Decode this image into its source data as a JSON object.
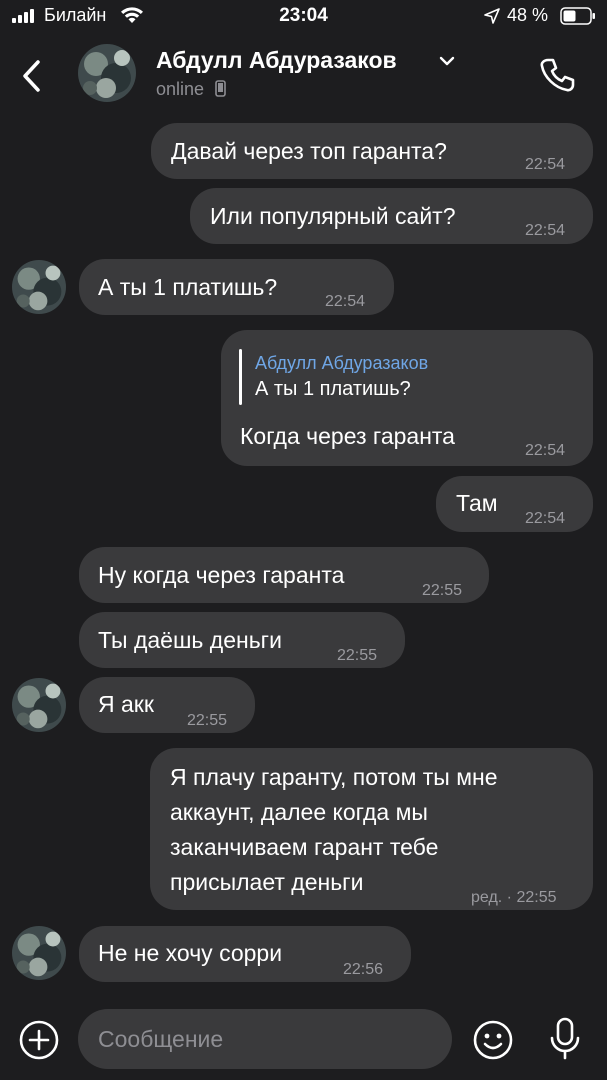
{
  "status_bar": {
    "carrier": "Билайн",
    "time": "23:04",
    "battery": "48 %"
  },
  "header": {
    "contact_name": "Абдулл Абдуразаков",
    "status": "online"
  },
  "messages": [
    {
      "direction": "out",
      "text": "Давай через топ гаранта?",
      "time": "22:54"
    },
    {
      "direction": "out",
      "text": "Или популярный сайт?",
      "time": "22:54"
    },
    {
      "direction": "in",
      "text": "А ты 1 платишь?",
      "time": "22:54"
    },
    {
      "direction": "out",
      "reply_author": "Абдулл Абдуразаков",
      "reply_text": "А ты 1 платишь?",
      "text": "Когда через гаранта",
      "time": "22:54"
    },
    {
      "direction": "out",
      "text": "Там",
      "time": "22:54"
    },
    {
      "direction": "in",
      "text": "Ну когда через гаранта",
      "time": "22:55"
    },
    {
      "direction": "in",
      "text": "Ты даёшь деньги",
      "time": "22:55"
    },
    {
      "direction": "in",
      "text": "Я акк",
      "time": "22:55"
    },
    {
      "direction": "out",
      "lines": [
        "Я плачу гаранту, потом ты мне",
        "аккаунт, далее когда мы",
        "заканчиваем гарант тебе",
        "присылает деньги"
      ],
      "time": "ред. · 22:55"
    },
    {
      "direction": "in",
      "text": "Не не хочу сорри",
      "time": "22:56"
    }
  ],
  "composer": {
    "placeholder": "Сообщение"
  },
  "icons": {
    "back": "chevron-left-icon",
    "call": "phone-icon",
    "attach": "plus-circle-icon",
    "emoji": "emoji-icon",
    "mic": "microphone-icon"
  },
  "colors": {
    "background": "#1d1d1f",
    "bubble": "#3a3a3c",
    "reply_author": "#6fa6e6",
    "secondary_text": "#8e8e93"
  }
}
